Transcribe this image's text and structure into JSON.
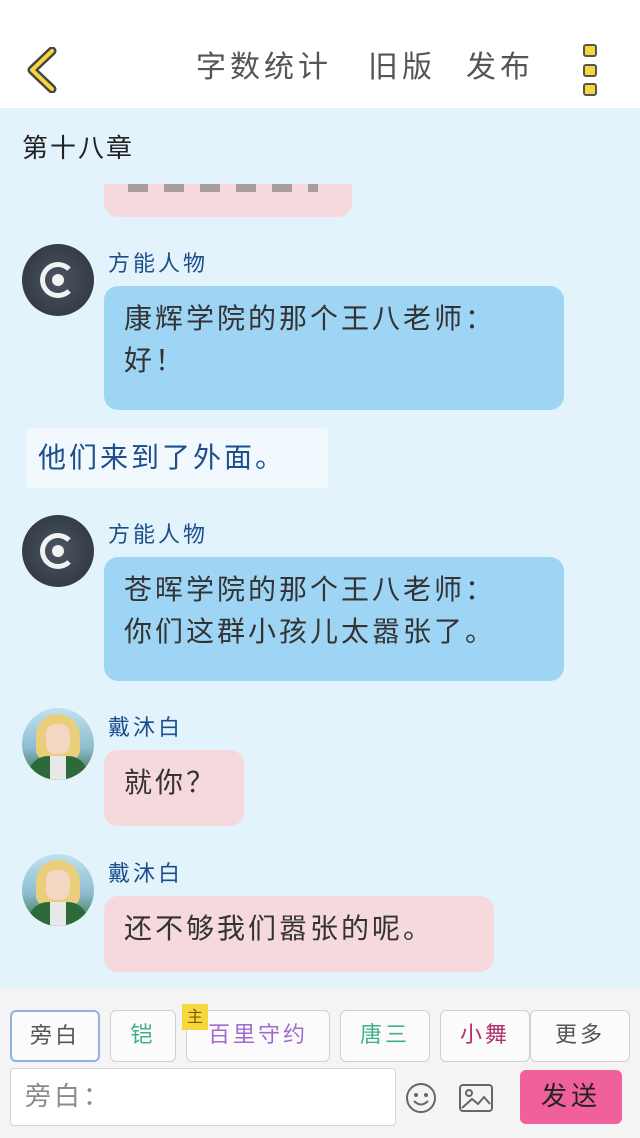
{
  "header": {
    "back_icon": "chevron-left-icon",
    "word_count_label": "字数统计",
    "old_version_label": "旧版",
    "publish_label": "发布",
    "more_icon": "more-vertical-icon",
    "accent_color": "#f6d63c"
  },
  "chapter": {
    "title": "第十八章"
  },
  "messages": [
    {
      "type": "character",
      "name": "方能人物",
      "avatar": "system-logo-avatar",
      "text": "康辉学院的那个王八老师：\n好！",
      "bubble_color": "#9fd5f4"
    },
    {
      "type": "narration",
      "text": "他们来到了外面。"
    },
    {
      "type": "character",
      "name": "方能人物",
      "avatar": "system-logo-avatar",
      "text": "苍晖学院的那个王八老师：\n你们这群小孩儿太嚣张了。",
      "bubble_color": "#9fd5f4"
    },
    {
      "type": "character",
      "name": "戴沐白",
      "avatar": "blond-hero-avatar",
      "text": "就你？",
      "bubble_color": "#f6d9dc"
    },
    {
      "type": "character",
      "name": "戴沐白",
      "avatar": "blond-hero-avatar",
      "text": "还不够我们嚣张的呢。",
      "bubble_color": "#f6d9dc"
    }
  ],
  "roles": [
    {
      "label": "旁白",
      "color": "#555555",
      "active": true
    },
    {
      "label": "铠",
      "color": "#3fae8c",
      "active": false
    },
    {
      "label": "百里守约",
      "color": "#a06ad0",
      "active": false,
      "tag": "主"
    },
    {
      "label": "唐三",
      "color": "#3fae8c",
      "active": false
    },
    {
      "label": "小舞",
      "color": "#b0306a",
      "active": false
    },
    {
      "label": "更多",
      "color": "#555555",
      "active": false
    }
  ],
  "composer": {
    "placeholder": "旁白：",
    "emoji_icon": "smiley-icon",
    "image_icon": "image-icon",
    "send_label": "发送",
    "send_color": "#f0609a"
  }
}
